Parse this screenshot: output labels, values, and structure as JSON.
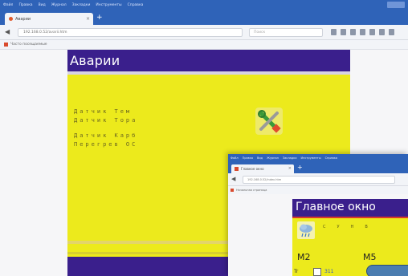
{
  "back_window": {
    "menu": [
      "Файл",
      "Правка",
      "Вид",
      "Журнал",
      "Закладки",
      "Инструменты",
      "Справка"
    ],
    "tab_label": "Аварии",
    "url": "192.168.0.52/avarii.htm",
    "search_placeholder": "Поиск",
    "bookmark": "Часто посещаемые",
    "page": {
      "title": "Аварии",
      "sensors": [
        "Датчик Тем",
        "Датчик Topa",
        "Датчик Карб",
        "Перегрев ОС"
      ],
      "tools_icon": "wrench-screwdriver-icon"
    }
  },
  "front_window": {
    "menu": [
      "Файл",
      "Правка",
      "Вид",
      "Журнал",
      "Закладки",
      "Инструменты",
      "Справка"
    ],
    "tab_label": "Главное окно",
    "url": "192.168.0.52/index.htm",
    "bookmark": "Начальная страница",
    "page": {
      "title": "Главное окно",
      "letters": [
        "С",
        "У",
        "Н",
        "В"
      ],
      "m2": "M2",
      "m5": "M5",
      "bottom_glyph": "Tr",
      "bottom_num": "311",
      "weather_icon": "cloud-rain-icon"
    }
  },
  "colors": {
    "browser_blue": "#2f63b8",
    "header_purple": "#3a1f8c",
    "panel_yellow": "#ecea1c"
  }
}
